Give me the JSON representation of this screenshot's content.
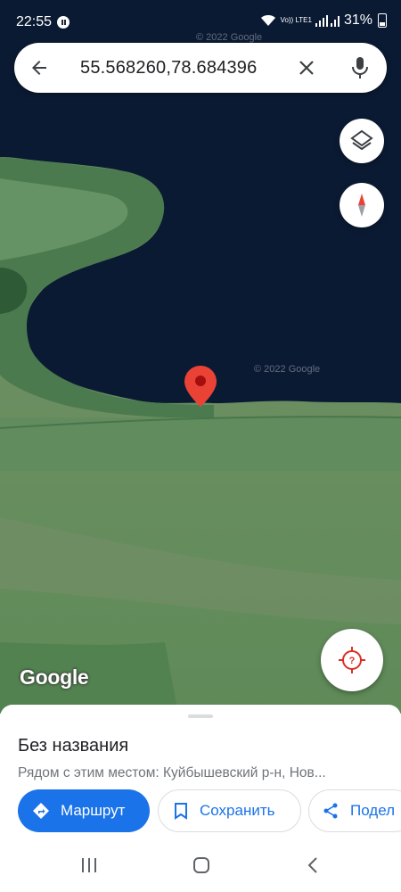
{
  "status_bar": {
    "time": "22:55",
    "network_label": "Vo)) LTE1",
    "battery": "31%"
  },
  "search": {
    "query": "55.568260,78.684396"
  },
  "map": {
    "attribution": "© 2022 Google",
    "attribution_2": "© 2022 Google",
    "logo": "Google"
  },
  "place": {
    "title": "Без названия",
    "subtitle": "Рядом с этим местом: Куйбышевский р-н, Нов..."
  },
  "actions": {
    "route_label": "Маршрут",
    "save_label": "Сохранить",
    "share_label": "Подел"
  },
  "icons": {
    "back": "arrow-left-icon",
    "clear": "close-icon",
    "mic": "microphone-icon",
    "layers": "layers-icon",
    "compass": "compass-icon",
    "locate": "location-unknown-icon",
    "pin": "map-pin-icon"
  },
  "colors": {
    "water": "#0b1a33",
    "field": "#5f8a5e",
    "accent_blue": "#1a73e8",
    "pin_red": "#ea4335"
  }
}
